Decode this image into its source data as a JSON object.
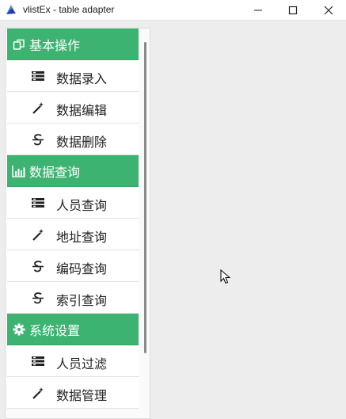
{
  "window": {
    "title": "vlistEx - table adapter",
    "buttons": {
      "minimize": "minimize-icon",
      "maximize": "maximize-icon",
      "close": "close-icon"
    }
  },
  "colors": {
    "group_header_bg": "#3cb371",
    "group_header_text": "#ffffff",
    "item_bg": "#ffffff",
    "window_bg": "#ededed"
  },
  "nav": {
    "groups": [
      {
        "label": "基本操作",
        "icon": "copy-icon",
        "items": [
          {
            "label": "数据录入",
            "icon": "list-icon"
          },
          {
            "label": "数据编辑",
            "icon": "magic-wand-icon"
          },
          {
            "label": "数据删除",
            "icon": "strikethrough-icon"
          }
        ]
      },
      {
        "label": "数据查询",
        "icon": "bar-chart-icon",
        "items": [
          {
            "label": "人员查询",
            "icon": "list-icon"
          },
          {
            "label": "地址查询",
            "icon": "magic-wand-icon"
          },
          {
            "label": "编码查询",
            "icon": "strikethrough-icon"
          },
          {
            "label": "索引查询",
            "icon": "strikethrough-icon"
          }
        ]
      },
      {
        "label": "系统设置",
        "icon": "gear-icon",
        "items": [
          {
            "label": "人员过滤",
            "icon": "list-icon"
          },
          {
            "label": "数据管理",
            "icon": "magic-wand-icon"
          }
        ]
      }
    ]
  }
}
